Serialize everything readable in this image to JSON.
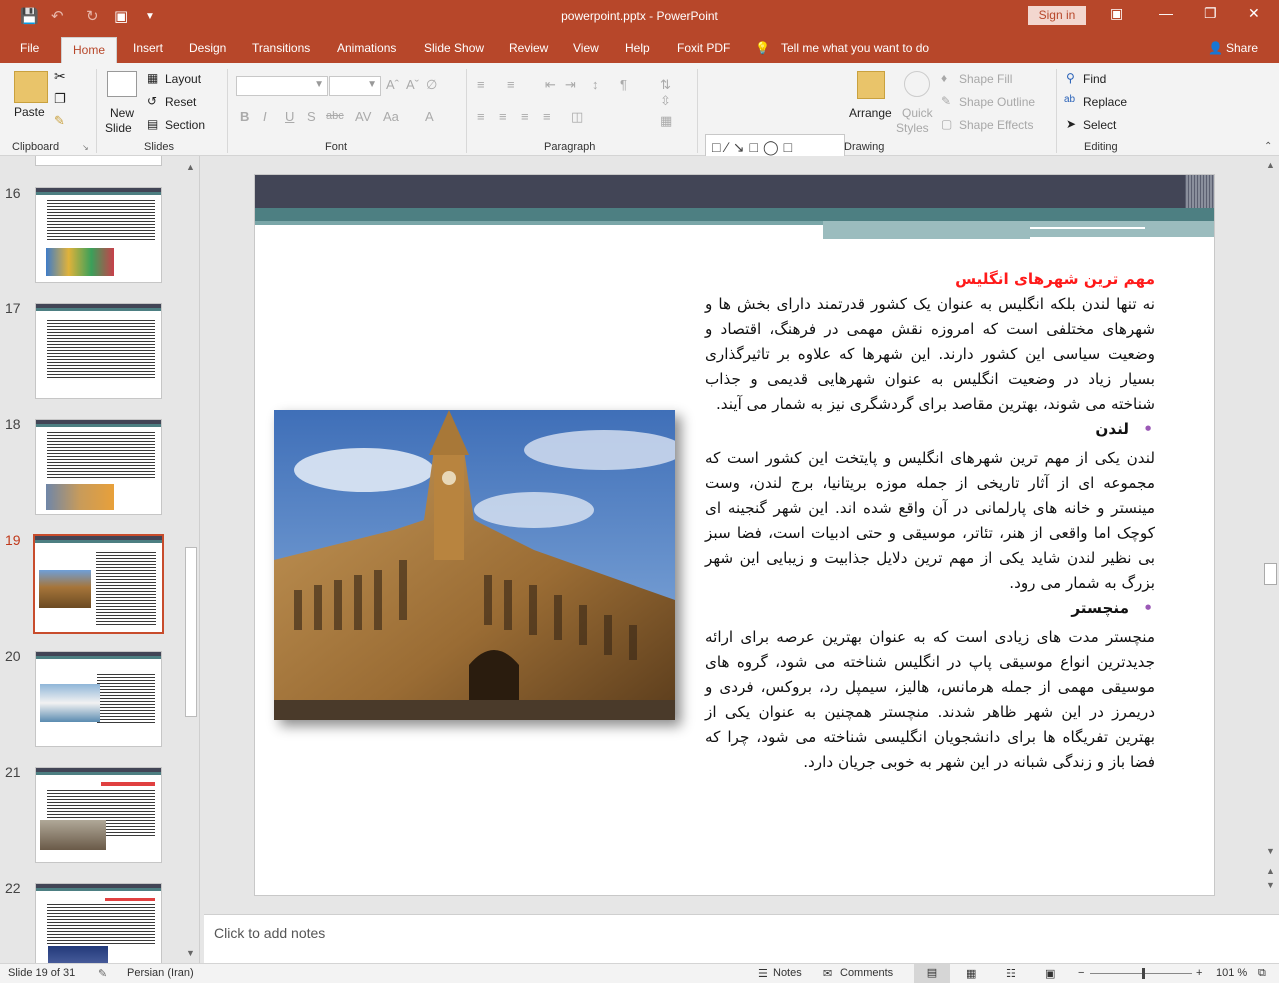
{
  "titlebar": {
    "title": "powerpoint.pptx  -  PowerPoint",
    "sign_in": "Sign in"
  },
  "tabs": [
    "File",
    "Home",
    "Insert",
    "Design",
    "Transitions",
    "Animations",
    "Slide Show",
    "Review",
    "View",
    "Help",
    "Foxit PDF"
  ],
  "tell_me": "Tell me what you want to do",
  "share": "Share",
  "ribbon": {
    "clipboard": {
      "paste": "Paste",
      "label": "Clipboard"
    },
    "slides": {
      "new_slide": "New",
      "new_slide2": "Slide",
      "layout": "Layout",
      "reset": "Reset",
      "section": "Section",
      "label": "Slides"
    },
    "font": {
      "label": "Font"
    },
    "paragraph": {
      "label": "Paragraph"
    },
    "drawing": {
      "arrange": "Arrange",
      "quick_styles": "Quick",
      "quick_styles2": "Styles",
      "shape_fill": "Shape Fill",
      "shape_outline": "Shape Outline",
      "shape_effects": "Shape Effects",
      "label": "Drawing"
    },
    "editing": {
      "find": "Find",
      "replace": "Replace",
      "select": "Select",
      "label": "Editing"
    }
  },
  "thumbnails": [
    {
      "num": "16"
    },
    {
      "num": "17"
    },
    {
      "num": "18"
    },
    {
      "num": "19"
    },
    {
      "num": "20"
    },
    {
      "num": "21"
    },
    {
      "num": "22"
    }
  ],
  "slide": {
    "heading": "مهم ترین شهرهای انگلیس",
    "para1": "نه تنها لندن بلکه انگلیس به عنوان یک کشور قدرتمند دارای بخش ها و شهرهای مختلفی است که امروزه نقش مهمی در فرهنگ، اقتصاد و وضعیت سیاسی این کشور دارند. این شهرها که علاوه بر تاثیرگذاری بسیار زیاد در وضعیت انگلیس به عنوان شهرهایی قدیمی و جذاب شناخته می شوند، بهترین مقاصد برای گردشگری نیز به شمار می آیند.",
    "bullet1": "لندن",
    "para2": "لندن یکی از مهم ترین شهرهای انگلیس و پایتخت این کشور است که مجموعه ای از آثار تاریخی از جمله موزه بریتانیا، برج لندن، وست مینستر و خانه های پارلمانی در آن واقع شده اند. این شهر گنجینه ای کوچک اما واقعی از هنر، تئاتر، موسیقی و حتی ادبیات است، فضا سبز بی نظیر لندن شاید یکی از مهم ترین دلایل جذابیت و زیبایی این شهر بزرگ به شمار می رود.",
    "bullet2": "منچستر",
    "para3": "منچستر مدت های زیادی است که به عنوان بهترین عرصه برای ارائه جدیدترین انواع موسیقی پاپ در انگلیس شناخته می شود، گروه های موسیقی مهمی از جمله هرمانس، هالیز، سیمپل رد، بروکس، فردی و دریمرز در این شهر ظاهر شدند. منچستر همچنین به عنوان یکی از بهترین تفریگاه ها برای دانشجویان انگلیسی شناخته می شود، چرا که فضا باز و زندگی شبانه در این شهر به خوبی جریان دارد."
  },
  "notes_placeholder": "Click to add notes",
  "status": {
    "slide": "Slide 19 of 31",
    "language": "Persian (Iran)",
    "notes": "Notes",
    "comments": "Comments",
    "zoom": "101 %"
  }
}
